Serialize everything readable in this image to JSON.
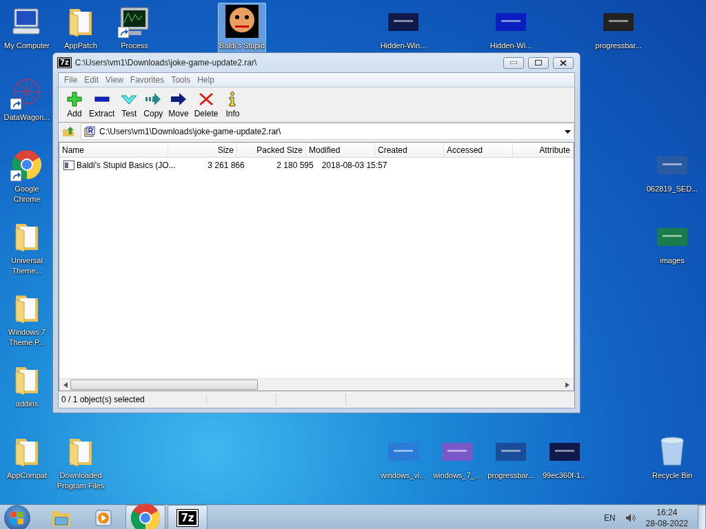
{
  "desktop": {
    "icons": [
      {
        "label": "My Computer",
        "kind": "computer",
        "shortcut": false,
        "selected": false
      },
      {
        "label": "AppPatch",
        "kind": "folder",
        "shortcut": false,
        "selected": false
      },
      {
        "label": "Process",
        "kind": "monitor",
        "shortcut": true,
        "selected": false
      },
      {
        "label": "Baldi's Stupid",
        "kind": "face",
        "shortcut": false,
        "selected": true
      },
      {
        "label": "Hidden-Win...",
        "kind": "thumbnail",
        "shortcut": false,
        "selected": false
      },
      {
        "label": "Hidden-Wi...",
        "kind": "thumbnail",
        "shortcut": false,
        "selected": false
      },
      {
        "label": "progressbar...",
        "kind": "thumbnail",
        "shortcut": false,
        "selected": false
      },
      {
        "label": "DataWagon...",
        "kind": "network",
        "shortcut": true,
        "selected": false
      },
      {
        "label": "Google Chrome",
        "kind": "chrome",
        "shortcut": true,
        "selected": false
      },
      {
        "label": "062819_SED...",
        "kind": "thumbnail",
        "shortcut": false,
        "selected": false
      },
      {
        "label": "Universal Theme...",
        "kind": "folder",
        "shortcut": false,
        "selected": false
      },
      {
        "label": "images",
        "kind": "thumbnail",
        "shortcut": false,
        "selected": false
      },
      {
        "label": "Windows 7 Theme P...",
        "kind": "folder",
        "shortcut": false,
        "selected": false
      },
      {
        "label": "addins",
        "kind": "folder",
        "shortcut": false,
        "selected": false
      },
      {
        "label": "AppCompat",
        "kind": "folder",
        "shortcut": false,
        "selected": false
      },
      {
        "label": "Downloaded Program Files",
        "kind": "folder",
        "shortcut": false,
        "selected": false
      },
      {
        "label": "windows_vi...",
        "kind": "thumbnail",
        "shortcut": false,
        "selected": false
      },
      {
        "label": "windows_7_...",
        "kind": "thumbnail",
        "shortcut": false,
        "selected": false
      },
      {
        "label": "progressbar...",
        "kind": "thumbnail",
        "shortcut": false,
        "selected": false
      },
      {
        "label": "99ec360f-1...",
        "kind": "thumbnail",
        "shortcut": false,
        "selected": false
      },
      {
        "label": "Recycle Bin",
        "kind": "recycle",
        "shortcut": false,
        "selected": false
      }
    ]
  },
  "window": {
    "logo": "7z",
    "title": "C:\\Users\\vm1\\Downloads\\joke-game-update2.rar\\",
    "menu": [
      "File",
      "Edit",
      "View",
      "Favorites",
      "Tools",
      "Help"
    ],
    "toolbar": [
      {
        "label": "Add",
        "kind": "add"
      },
      {
        "label": "Extract",
        "kind": "extract"
      },
      {
        "label": "Test",
        "kind": "test"
      },
      {
        "label": "Copy",
        "kind": "copy"
      },
      {
        "label": "Move",
        "kind": "move"
      },
      {
        "label": "Delete",
        "kind": "delete"
      },
      {
        "label": "Info",
        "kind": "info"
      }
    ],
    "address": "C:\\Users\\vm1\\Downloads\\joke-game-update2.rar\\",
    "table": {
      "columns": [
        "Name",
        "Size",
        "Packed Size",
        "Modified",
        "Created",
        "Accessed",
        "Attribute"
      ],
      "rows": [
        {
          "cells": [
            "Baldi's Stupid Basics (JO...",
            "3 261 866",
            "2 180 595",
            "2018-08-03 15:57"
          ],
          "selected": false
        }
      ]
    },
    "status_bar": "0 / 1 object(s) selected"
  },
  "taskbar": {
    "apps": [
      {
        "kind": "explorer",
        "running": false
      },
      {
        "kind": "media",
        "running": false
      },
      {
        "kind": "chrome",
        "running": true
      },
      {
        "kind": "sevenzip",
        "running": true,
        "logo": "7z"
      }
    ],
    "language": "EN",
    "time": "16:24",
    "date": "28-08-2022"
  }
}
